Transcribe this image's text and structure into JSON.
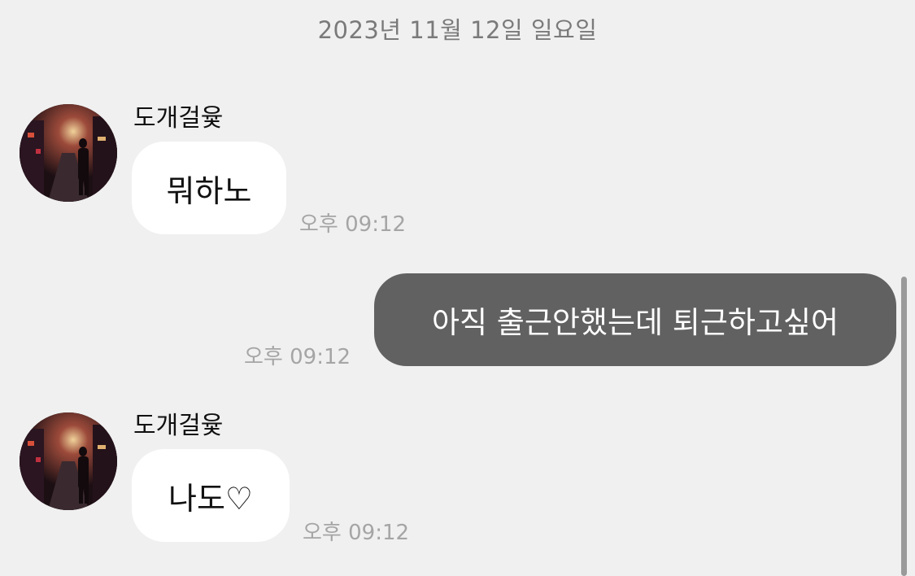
{
  "chat": {
    "date": "2023년 11월 12일 일요일",
    "messages": [
      {
        "direction": "incoming",
        "sender": "도개걸윷",
        "text": "뭐하노",
        "time": "오후 09:12"
      },
      {
        "direction": "outgoing",
        "text": "아직 출근안했는데 퇴근하고싶어",
        "time": "오후 09:12"
      },
      {
        "direction": "incoming",
        "sender": "도개걸윷",
        "text": "나도♡",
        "time": "오후 09:12"
      }
    ]
  },
  "icons": {
    "avatar": "profile-photo-night-alley",
    "scrollbar": "vertical-scrollbar"
  },
  "colors": {
    "background": "#f0f0f0",
    "incoming_bubble": "#ffffff",
    "outgoing_bubble": "#616161",
    "outgoing_text": "#ffffff",
    "timestamp": "#a5a5a5",
    "date_header": "#7a7a7a"
  }
}
